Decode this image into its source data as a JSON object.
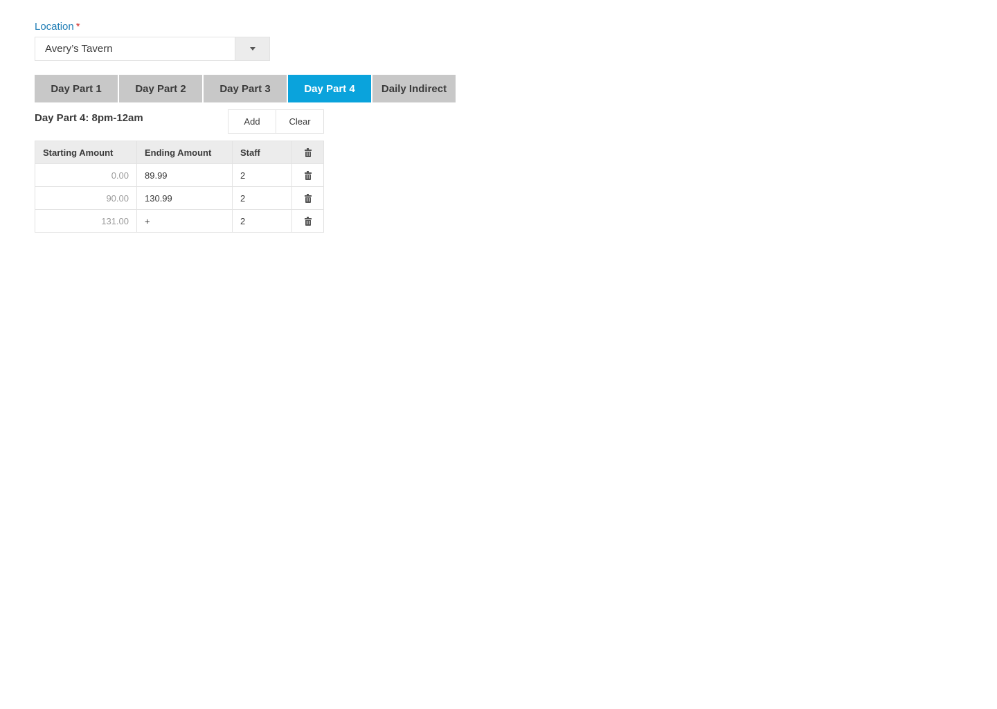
{
  "location": {
    "label": "Location",
    "required_mark": "*",
    "selected": "Avery’s Tavern"
  },
  "tabs": [
    {
      "label": "Day Part 1",
      "active": false
    },
    {
      "label": "Day Part 2",
      "active": false
    },
    {
      "label": "Day Part 3",
      "active": false
    },
    {
      "label": "Day Part 4",
      "active": true
    },
    {
      "label": "Daily Indirect",
      "active": false
    }
  ],
  "section": {
    "title": "Day Part 4: 8pm-12am",
    "add_label": "Add",
    "clear_label": "Clear"
  },
  "table": {
    "headers": [
      "Starting Amount",
      "Ending Amount",
      "Staff"
    ],
    "rows": [
      {
        "start": "0.00",
        "end": "89.99",
        "staff": "2"
      },
      {
        "start": "90.00",
        "end": "130.99",
        "staff": "2"
      },
      {
        "start": "131.00",
        "end": "+",
        "staff": "2"
      }
    ]
  },
  "colors": {
    "accent": "#0aa3dc",
    "label": "#1f7db5",
    "required": "#d0312d",
    "tab_inactive": "#c8c8c8"
  }
}
